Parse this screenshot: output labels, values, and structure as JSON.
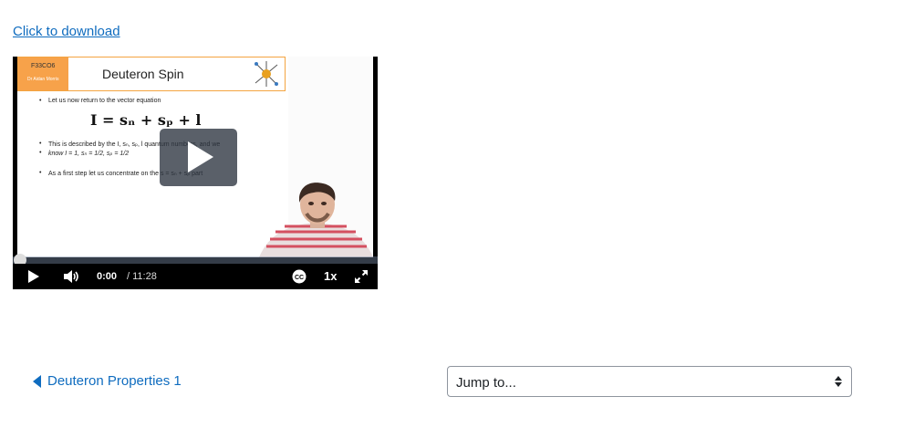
{
  "download": {
    "label": "Click to download"
  },
  "video": {
    "slide": {
      "code": "F33CO6",
      "author": "Dr Aidan Morris",
      "title": "Deuteron Spin",
      "bullet1": "Let us now return to the vector equation",
      "equation": "I = sₙ + sₚ + l",
      "bullet2a": "This is described by the  I, sₙ, sₚ, l  quantum numbers, and we",
      "bullet2b": "know  I = 1, sₙ = 1/2, sₚ = 1/2",
      "bullet3": "As a first step let us concentrate on the  s = sₙ + sₚ  part"
    },
    "controls": {
      "current_time": "0:00",
      "duration": "/ 11:28",
      "playback_rate": "1x",
      "progress": 0
    }
  },
  "nav": {
    "prev_label": "Deuteron Properties 1",
    "jump_label": "Jump to..."
  },
  "colors": {
    "link": "#0f6cbf",
    "slide_accent": "#f7a24a"
  }
}
